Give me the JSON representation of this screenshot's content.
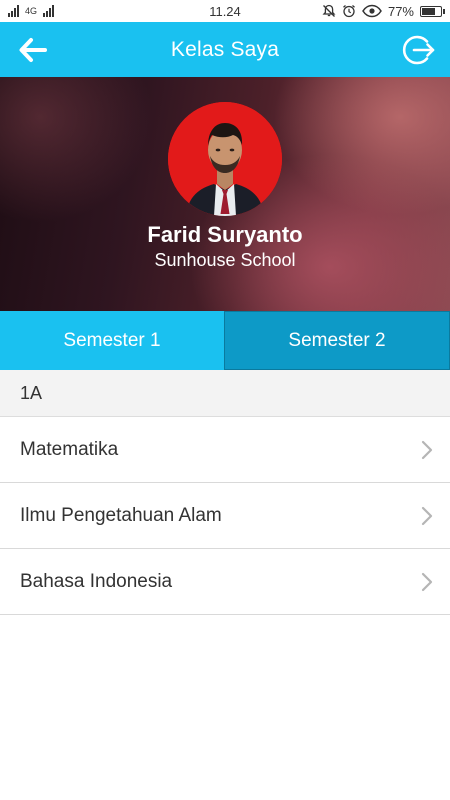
{
  "status_bar": {
    "signal_label": "4G",
    "time": "11.24",
    "battery": "77%",
    "battery_level": 0.77
  },
  "app_bar": {
    "title": "Kelas Saya",
    "back_icon": "arrow-left-icon",
    "logout_icon": "logout-icon"
  },
  "profile": {
    "name": "Farid Suryanto",
    "school": "Sunhouse School",
    "avatar_bg": "#e21a1a"
  },
  "tabs": [
    {
      "label": "Semester 1",
      "active": false
    },
    {
      "label": "Semester 2",
      "active": true
    }
  ],
  "section": {
    "title": "1A"
  },
  "subjects": [
    {
      "label": "Matematika"
    },
    {
      "label": "Ilmu Pengetahuan Alam"
    },
    {
      "label": "Bahasa Indonesia"
    }
  ],
  "colors": {
    "primary": "#1ac1f0",
    "tab_active": "#0d9ac7",
    "section_bg": "#f3f3f3"
  }
}
